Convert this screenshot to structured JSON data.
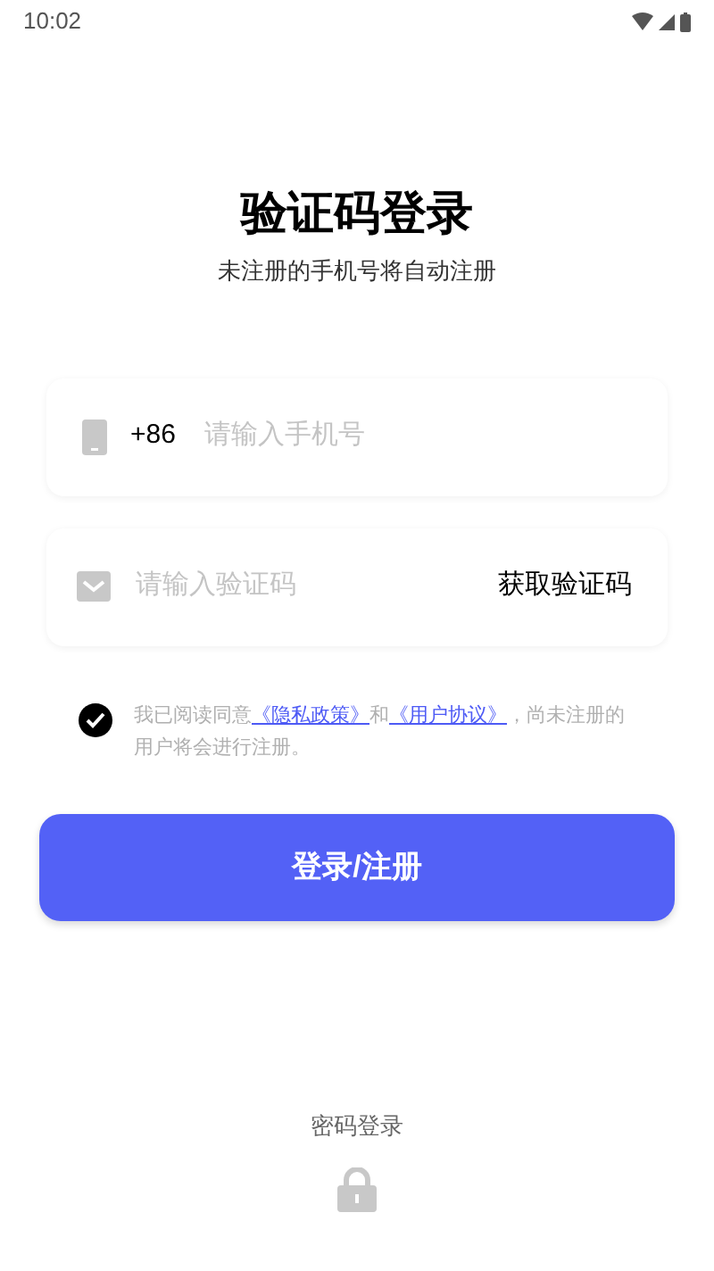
{
  "status_bar": {
    "time": "10:02"
  },
  "title": "验证码登录",
  "subtitle": "未注册的手机号将自动注册",
  "phone_field": {
    "prefix": "+86",
    "placeholder": "请输入手机号"
  },
  "code_field": {
    "placeholder": "请输入验证码",
    "action": "获取验证码"
  },
  "agreement": {
    "checked": true,
    "parts": [
      {
        "kind": "text",
        "text": "我已阅读同意"
      },
      {
        "kind": "link",
        "text": "《隐私政策》"
      },
      {
        "kind": "text",
        "text": "和"
      },
      {
        "kind": "link",
        "text": "《用户协议》"
      },
      {
        "kind": "text",
        "text": "，尚未注册的用户将会进行注册。"
      }
    ]
  },
  "submit_button": "登录/注册",
  "password_login": "密码登录"
}
